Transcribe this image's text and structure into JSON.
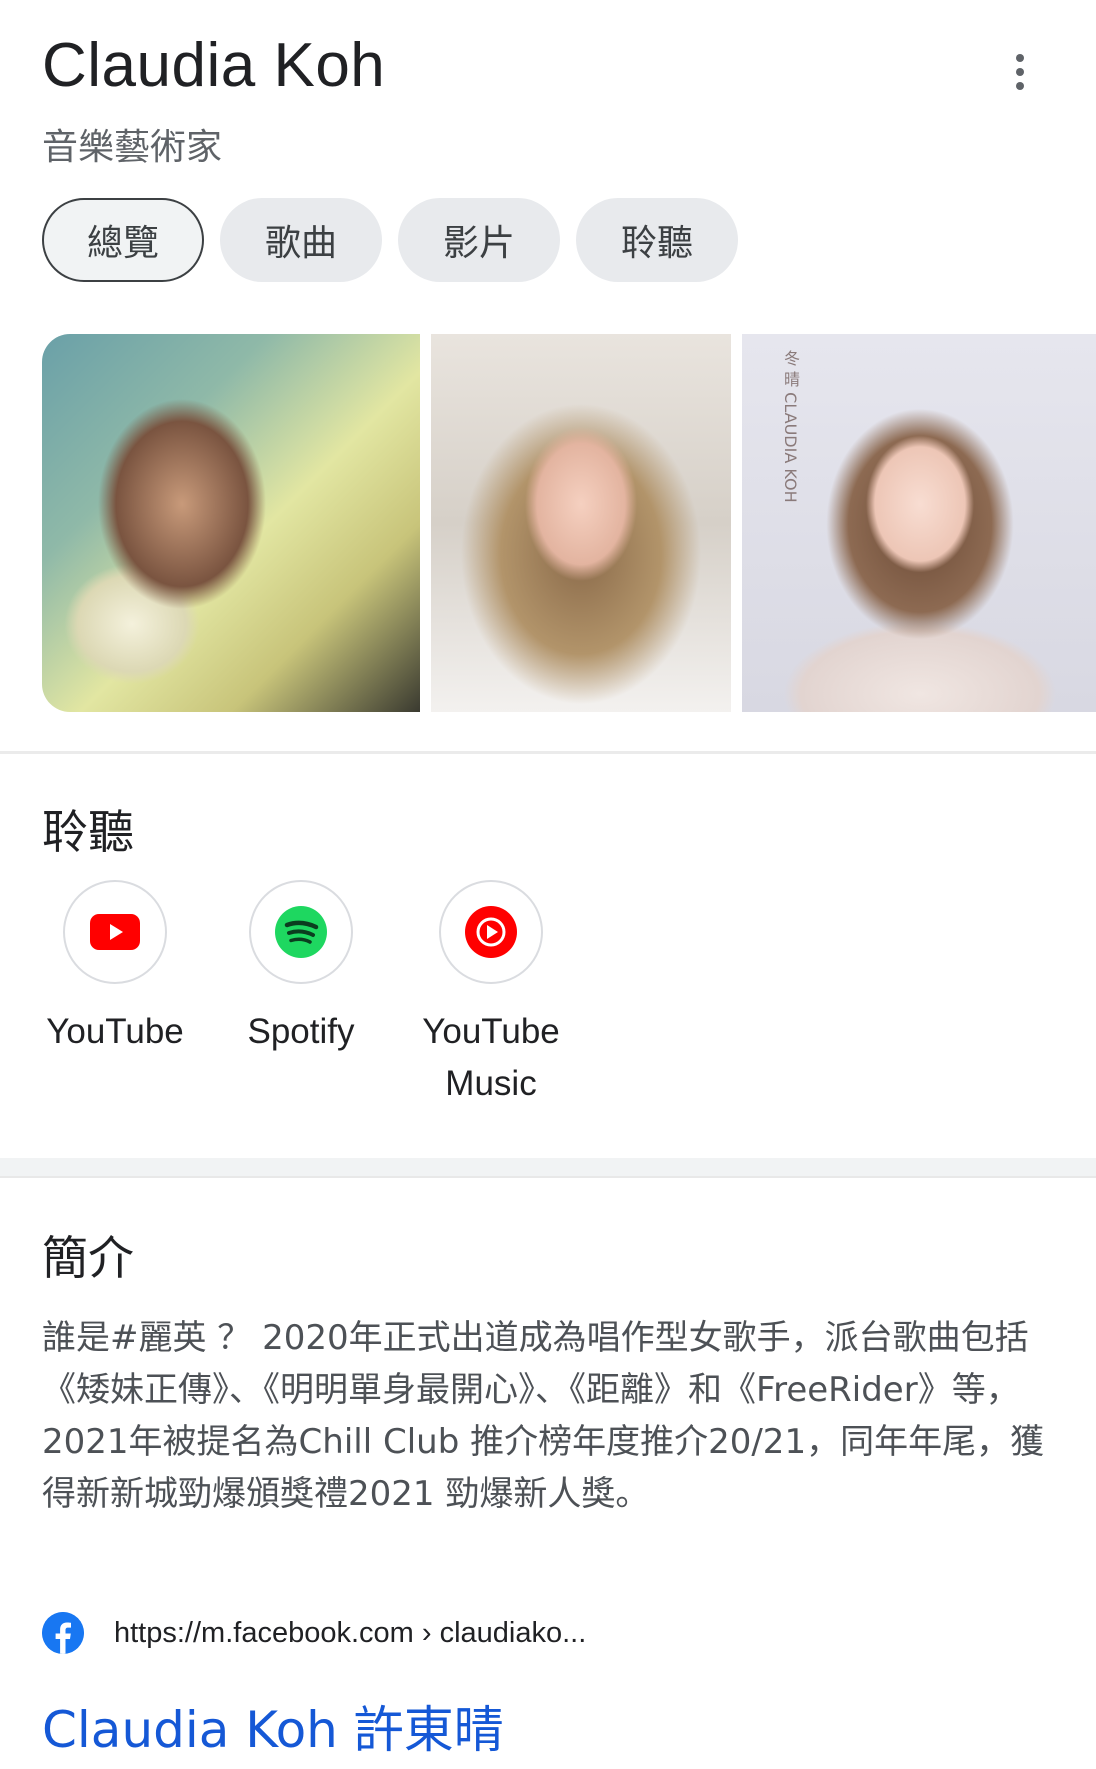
{
  "header": {
    "title": "Claudia Koh",
    "subtitle": "音樂藝術家"
  },
  "tabs": [
    {
      "label": "總覽",
      "active": true
    },
    {
      "label": "歌曲",
      "active": false
    },
    {
      "label": "影片",
      "active": false
    },
    {
      "label": "聆聽",
      "active": false
    }
  ],
  "images": {
    "third_cover_text": "冬 晴 CLAUDIA KOH"
  },
  "listen": {
    "title": "聆聽",
    "services": [
      {
        "label": "YouTube",
        "icon": "youtube-icon",
        "color": "#ff0000"
      },
      {
        "label": "Spotify",
        "icon": "spotify-icon",
        "color": "#1ed760"
      },
      {
        "label": "YouTube Music",
        "icon": "youtube-music-icon",
        "color": "#ff0000"
      }
    ]
  },
  "about": {
    "title": "簡介",
    "text": "誰是#麗英 ？ 2020年正式出道成為唱作型女歌手，派台歌曲包括《矮妹正傳》、《明明單身最開心》、《距離》和《FreeRider》等，2021年被提名為Chill Club 推介榜年度推介20/21，同年年尾，獲得新新城勁爆頒獎禮2021 勁爆新人獎。"
  },
  "source": {
    "url": "https://m.facebook.com › claudiako...",
    "icon": "facebook-icon",
    "icon_color": "#1877f2"
  },
  "result": {
    "title": "Claudia Koh 許東晴"
  }
}
